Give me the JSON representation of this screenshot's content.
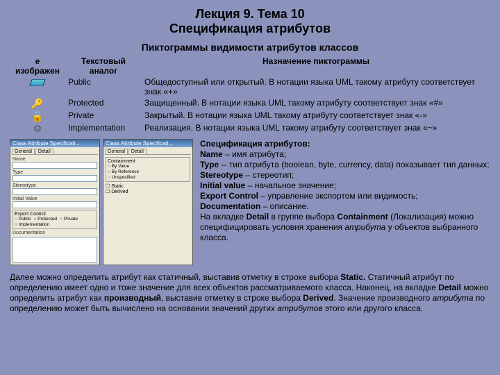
{
  "title": {
    "line1": "Лекция 9. Тема 10",
    "line2": "Спецификация атрибутов"
  },
  "subtitle": "Пиктограммы видимости атрибутов классов",
  "headers": {
    "col1a": "е",
    "col1b": "изображен",
    "col2a": "Текстовый",
    "col2b": "аналог",
    "col3": "Назначение пиктограммы"
  },
  "rows": [
    {
      "analog": "Public",
      "desc": "Общедоступный или открытый. В нотации языка UML такому атрибуту соответствует знак «+»"
    },
    {
      "analog": "Protected",
      "desc": "Защищенный. В нотации языка UML такому атрибуту соответствует знак «#»"
    },
    {
      "analog": "Private",
      "desc": "Закрытый. В нотации языка UML такому атрибуту соответствует знак «-»"
    },
    {
      "analog": "Implementation",
      "desc": "Реализация. В нотации языка UML такому атрибуту соответствует знак «~»"
    }
  ],
  "dialog": {
    "title": "Class Attribute Specificati...",
    "tabs": {
      "general": "General",
      "detail": "Detail"
    },
    "labels": {
      "name": "Name",
      "type": "Type",
      "stereotype": "Stereotype",
      "init": "Initial Value",
      "export": "Export Control",
      "doc": "Documentation",
      "containment": "Containment",
      "byval": "By Value",
      "byref": "By Reference",
      "unspec": "Unspecified",
      "static": "Static",
      "derived": "Derived"
    },
    "radios": {
      "public": "Public",
      "protected": "Protected",
      "private": "Private",
      "impl": "Implementation"
    }
  },
  "spec": {
    "head": "Спецификация атрибутов:",
    "name_b": "Name",
    "name_t": " – имя атрибута;",
    "type_b": "Type",
    "type_t": " -- тип атрибута (boolean, byte, currency, data) показывает тип данных;",
    "ster_b": "Stereotype",
    "ster_t": " – стереотип;",
    "init_b": "Initial value",
    "init_t": " – начальное значение;",
    "exp_b": "Export Control",
    "exp_t": " – управление экспортом или видимость;",
    "doc_b": "Documentation",
    "doc_t": " – описание.",
    "detail_pre": "На вкладке ",
    "detail_b": "Detail",
    "detail_mid": " в группе выбора ",
    "cont_b": "Containment",
    "detail_post": " (Локализация) можно специфицировать условия хранения ",
    "attr_i": "атрибута",
    "detail_end": " у объектов выбранного класса."
  },
  "bottom": {
    "p1a": "Далее можно определить атрибут как статичный, выставив отметку в строке выбора ",
    "static_b": "Static.",
    "p1b": " Статичный атрибут по определению имеет одно и тоже значение для всех объектов рассматриваемого класса. Наконец, на вкладке ",
    "detail_b": "Detail",
    "p1c": " можно определить атрибут как ",
    "deriv_b": "производный",
    "p1d": ", выставив отметку в строке выбора ",
    "derived_b": "Derived",
    "p1e": ". Значение производного ",
    "attr_i1": "атрибута",
    "p1f": " по определению может быть вычислено на основании значений других ",
    "attr_i2": "атрибутов",
    "p1g": " этого или другого класса."
  }
}
